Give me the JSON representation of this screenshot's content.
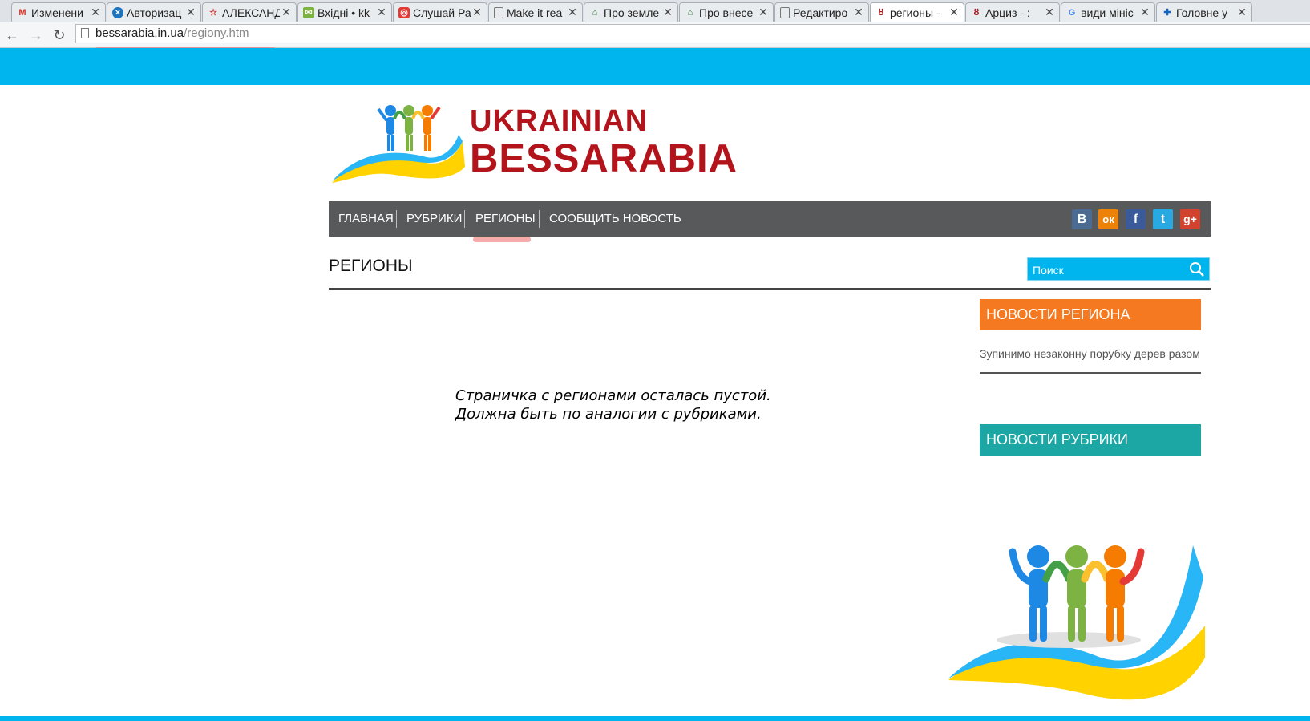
{
  "browser": {
    "tabs": [
      {
        "title": "Изменени",
        "icon": "gmail-icon",
        "active": false
      },
      {
        "title": "Авторизац",
        "icon": "blue-globe-icon",
        "active": false
      },
      {
        "title": "АЛЕКСАНД",
        "icon": "red-star-icon",
        "active": false
      },
      {
        "title": "Вхідні • kk",
        "icon": "mail-icon",
        "active": false
      },
      {
        "title": "Слушай Ра",
        "icon": "radio-icon",
        "active": false
      },
      {
        "title": "Make it rea",
        "icon": "page-icon",
        "active": false
      },
      {
        "title": "Про земле",
        "icon": "gov-icon",
        "active": false
      },
      {
        "title": "Про внесе",
        "icon": "gov-icon",
        "active": false
      },
      {
        "title": "Редактиро",
        "icon": "page-icon",
        "active": false
      },
      {
        "title": "регионы -",
        "icon": "bessarabia-icon",
        "active": true
      },
      {
        "title": "Арциз - :",
        "icon": "bessarabia-icon",
        "active": false
      },
      {
        "title": "види мініс",
        "icon": "google-icon",
        "active": false
      },
      {
        "title": "Головне у",
        "icon": "cross-icon",
        "active": false
      }
    ],
    "url_domain": "bessarabia.in.ua",
    "url_path": "/regiony.htm"
  },
  "site": {
    "logo_line1": "UKRAINIAN",
    "logo_line2": "BESSARABIA",
    "menu": [
      "ГЛАВНАЯ",
      "РУБРИКИ",
      "РЕГИОНЫ",
      "СООБЩИТЬ НОВОСТЬ"
    ],
    "social": [
      {
        "name": "vk",
        "label": "B",
        "color": "#4b6b92"
      },
      {
        "name": "odnoklassniki",
        "label": "ок",
        "color": "#ee8208"
      },
      {
        "name": "facebook",
        "label": "f",
        "color": "#3b5a9a"
      },
      {
        "name": "twitter",
        "label": "t",
        "color": "#29a9e1"
      },
      {
        "name": "google-plus",
        "label": "g+",
        "color": "#d1432f"
      }
    ],
    "page_title": "РЕГИОНЫ",
    "search_placeholder": "Поиск",
    "note_line1": "Страничка с регионами осталась пустой.",
    "note_line2": "Должна быть по аналогии с рубриками.",
    "sidebar": {
      "region_news_title": "НОВОСТИ РЕГИОНА",
      "region_news_color": "#f47920",
      "region_news_item": "Зупинимо незаконну порубку дерев разом",
      "rubric_news_title": "НОВОСТИ РУБРИКИ",
      "rubric_news_color": "#1ca7a5"
    },
    "accent_color": "#00b5ed",
    "logo_text_color": "#b3141b"
  }
}
